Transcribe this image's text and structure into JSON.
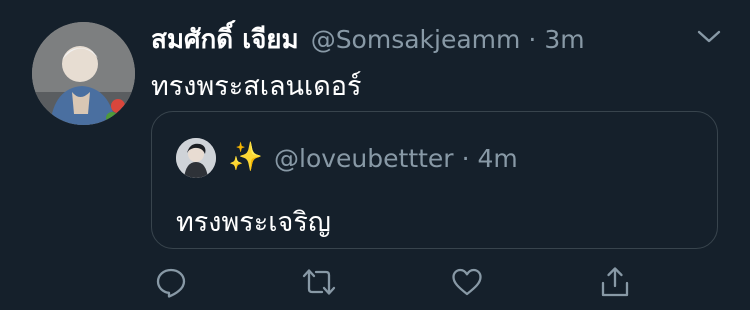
{
  "tweet": {
    "author_name": "สมศักดิ์ เจียม",
    "handle": "@Somsakjeamm",
    "separator": "·",
    "time": "3m",
    "text": "ทรงพระสเลนเดอร์"
  },
  "quoted_tweet": {
    "emoji_name": "✨",
    "handle": "@loveubettter",
    "separator": "·",
    "time": "4m",
    "text": "ทรงพระเจริญ"
  },
  "actions": {
    "reply_icon": "reply-icon",
    "retweet_icon": "retweet-icon",
    "like_icon": "like-icon",
    "share_icon": "share-icon"
  },
  "colors": {
    "background": "#15202b",
    "secondary_text": "#8899a6",
    "border": "#38444d",
    "primary_text": "#ffffff"
  }
}
